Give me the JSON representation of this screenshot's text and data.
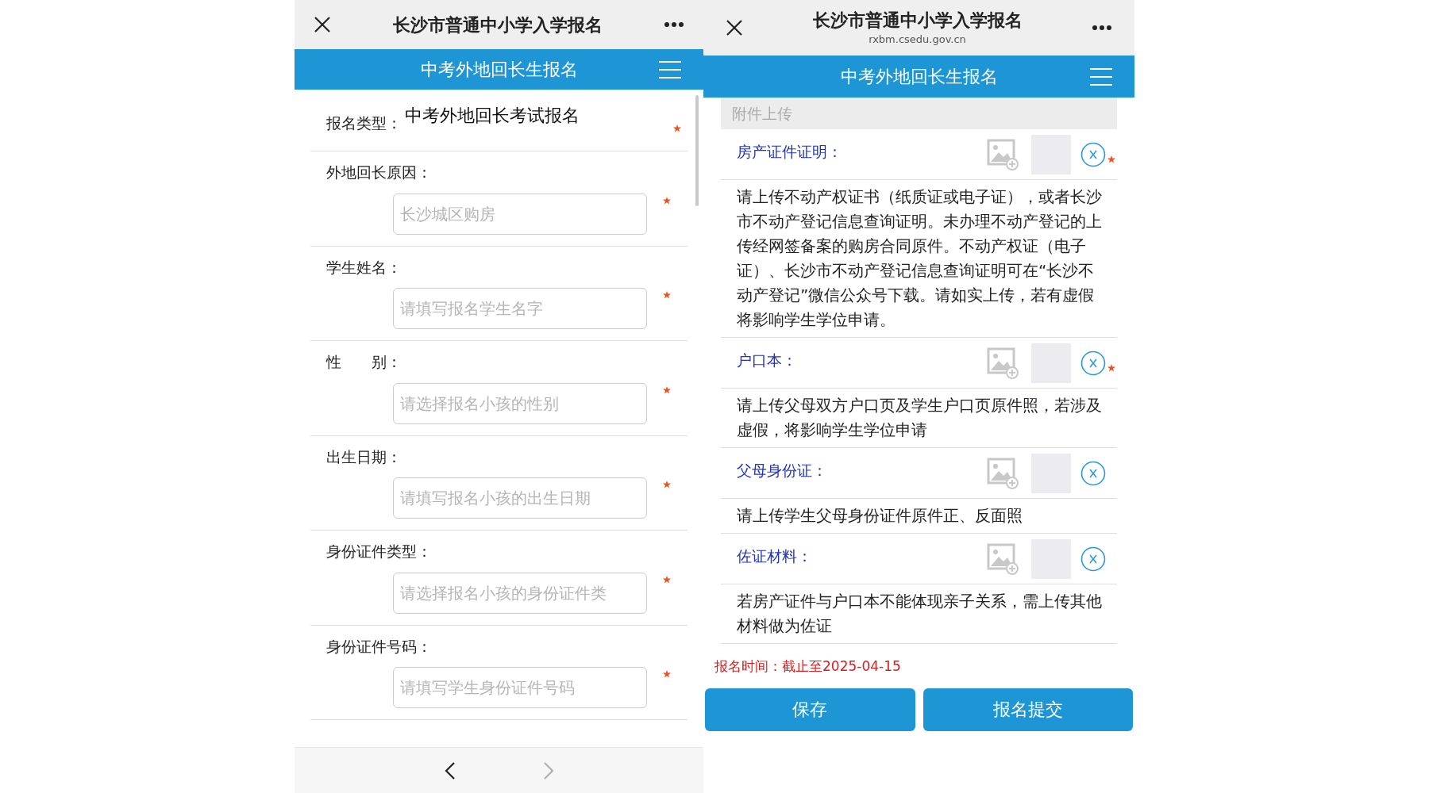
{
  "left_screen": {
    "title": "长沙市普通中小学入学报名",
    "banner": "中考外地回长生报名",
    "fields": [
      {
        "kind": "static",
        "label": "报名类型：",
        "value": "中考外地回长考试报名",
        "required": true
      },
      {
        "kind": "input",
        "label": "外地回长原因：",
        "placeholder": "长沙城区购房",
        "required": true
      },
      {
        "kind": "input",
        "label": "学生姓名：",
        "placeholder": "请填写报名学生名字",
        "required": true
      },
      {
        "kind": "input",
        "label": "性　　别：",
        "placeholder": "请选择报名小孩的性别",
        "required": true
      },
      {
        "kind": "input",
        "label": "出生日期：",
        "placeholder": "请填写报名小孩的出生日期",
        "required": true
      },
      {
        "kind": "input",
        "label": "身份证件类型：",
        "placeholder": "请选择报名小孩的身份证件类",
        "required": true
      },
      {
        "kind": "input",
        "label": "身份证件号码：",
        "placeholder": "请填写学生身份证件号码",
        "required": true
      }
    ],
    "nav": {
      "back_disabled": false,
      "forward_disabled": true
    }
  },
  "right_screen": {
    "title": "长沙市普通中小学入学报名",
    "url": "rxbm.csedu.gov.cn",
    "banner": "中考外地回长生报名",
    "section_title": "附件上传",
    "uploads": [
      {
        "label": "房产证件证明：",
        "required": true,
        "description": "请上传不动产权证书（纸质证或电子证），或者长沙市不动产登记信息查询证明。未办理不动产登记的上传经网签备案的购房合同原件。不动产权证（电子证）、长沙市不动产登记信息查询证明可在“长沙不动产登记”微信公众号下载。请如实上传，若有虚假将影响学生学位申请。"
      },
      {
        "label": "户口本：",
        "required": true,
        "description": "请上传父母双方户口页及学生户口页原件照，若涉及虚假，将影响学生学位申请"
      },
      {
        "label": "父母身份证：",
        "required": false,
        "description": "请上传学生父母身份证件原件正、反面照"
      },
      {
        "label": "佐证材料：",
        "required": false,
        "description": "若房产证件与户口本不能体现亲子关系，需上传其他材料做为佐证"
      }
    ],
    "deadline": "报名时间：截止至2025-04-15",
    "buttons": [
      {
        "label": "保存"
      },
      {
        "label": "报名提交"
      }
    ]
  }
}
